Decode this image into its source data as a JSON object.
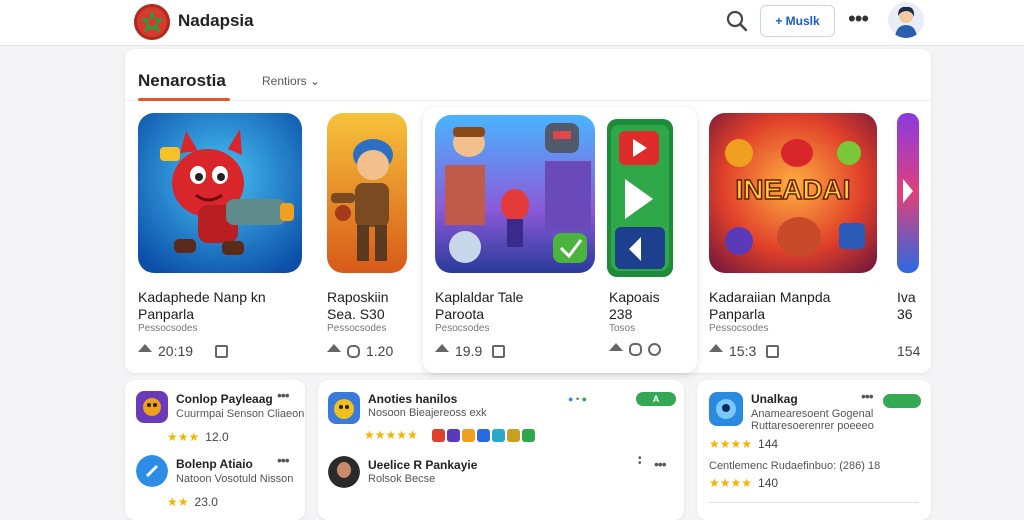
{
  "header": {
    "app_title": "Nadapsia",
    "add_button_label": "+ Muslk",
    "more_label": "•••"
  },
  "tabs": {
    "active": "Nenarostia",
    "secondary": "Rentiors"
  },
  "featured": [
    {
      "title": "Kadaphede Nanp kn",
      "subtitle": "Panparla",
      "meta": "Pessocsodes",
      "stat1": "20:19",
      "stat2": ""
    },
    {
      "title": "Raposkiin",
      "subtitle": "Sea. S30",
      "meta": "Pessocsodes",
      "stat1": "",
      "stat2": "1.20"
    },
    {
      "title": "Kaplaldar Tale",
      "subtitle": "Paroota",
      "meta": "Pesocsodes",
      "stat1": "19.9",
      "stat2": ""
    },
    {
      "title": "Kapoais",
      "subtitle": "238",
      "meta": "Tosos",
      "stat1": "",
      "stat2": ""
    },
    {
      "title": "Kadaraiian Manpda",
      "subtitle": "Panparla",
      "meta": "Pessocsodes",
      "stat1": "15:3",
      "stat2": ""
    },
    {
      "title": "Iva",
      "subtitle": "36",
      "meta": "",
      "stat1": "154",
      "stat2": ""
    }
  ],
  "list_left": [
    {
      "title": "Conlop Payleaag",
      "subtitle": "Cuurmpai Senson Cliaeon",
      "rating": "12.0",
      "stars": "★★★"
    },
    {
      "title": "Bolenp Atiaio",
      "subtitle": "Natoon Vosotuld Nisson",
      "rating": "23.0",
      "stars": "★★"
    }
  ],
  "list_middle": [
    {
      "title": "Anoties hanilos",
      "subtitle": "Nosoon Bieajereoss exk",
      "stars": "★★★★★"
    },
    {
      "title": "Ueelice R Pankayie",
      "subtitle": "Rolsok Becse"
    }
  ],
  "list_right": [
    {
      "title": "Unalkag",
      "subtitle1": "Anamearesoent Gogenal",
      "subtitle2": "Ruttaresoerenrer poeeeo",
      "stars": "★★★★",
      "rating": "144",
      "desc": "Centlemenc Rudaefinbuo: (286) 18",
      "stars2": "★★★★",
      "rating2": "140"
    }
  ],
  "badges": {
    "middle": "A",
    "right": ""
  },
  "colors": {
    "accent": "#e2572e",
    "link": "#1a5cc8",
    "star": "#f4b400",
    "badge": "#34a853"
  }
}
